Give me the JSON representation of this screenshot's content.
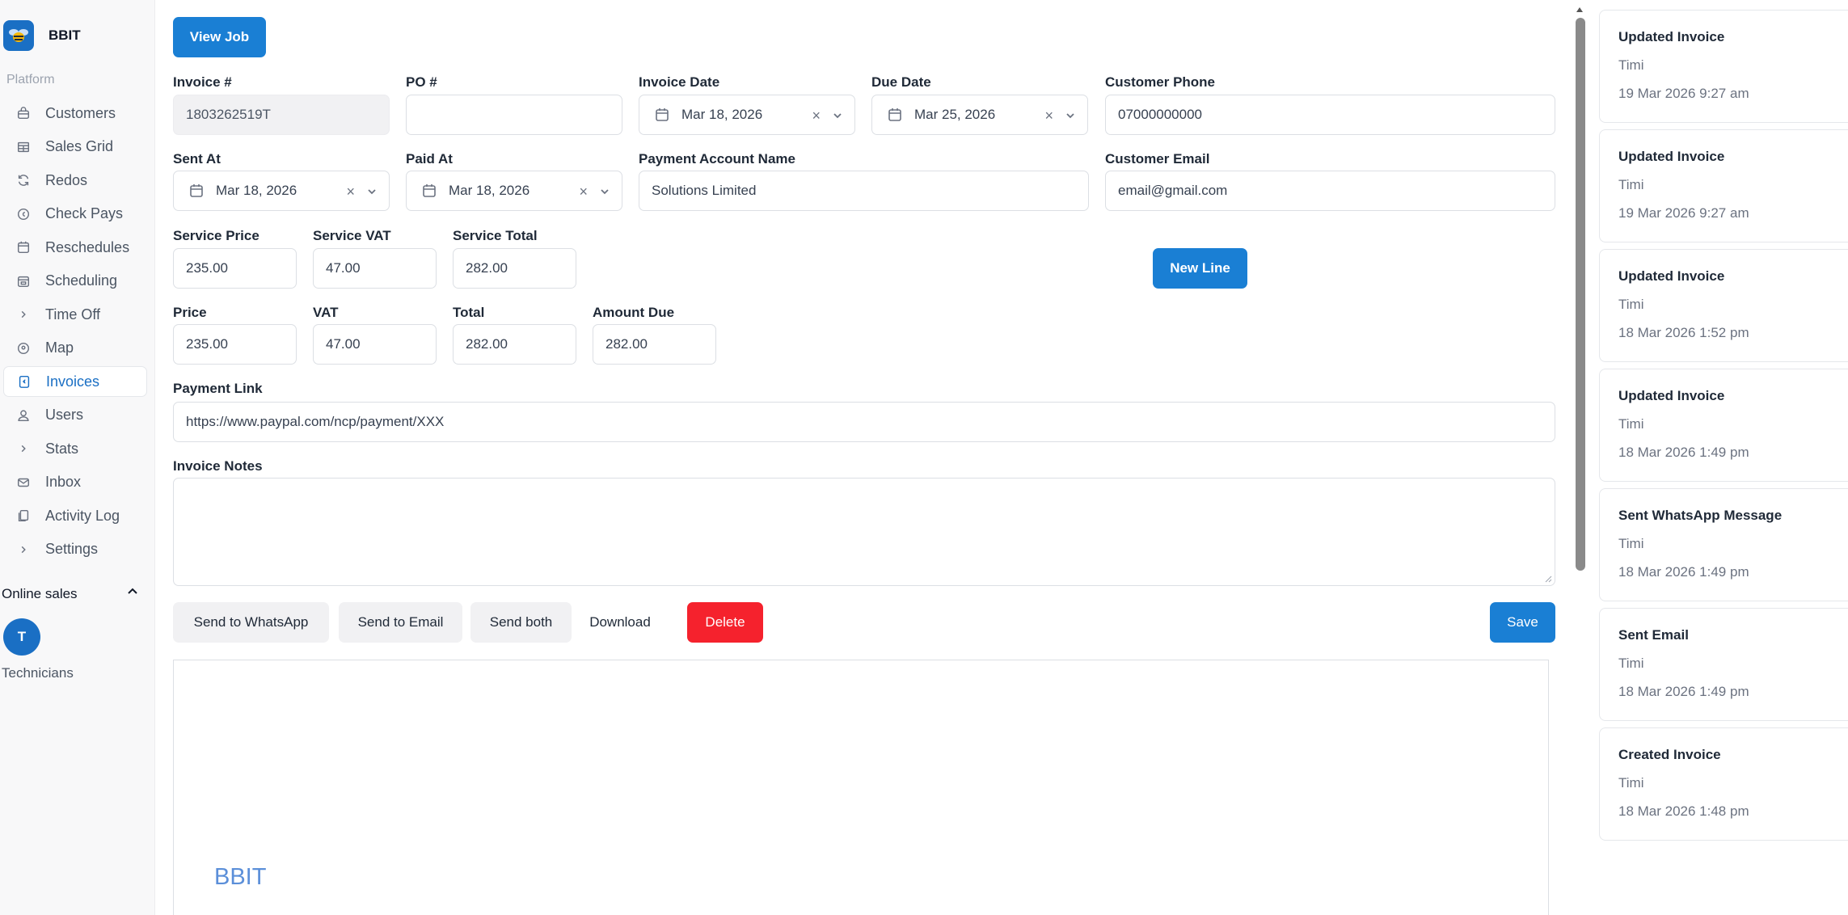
{
  "app": {
    "name": "BBIT"
  },
  "sidebar": {
    "group_label": "Platform",
    "items": [
      {
        "label": "Customers",
        "icon": "customers-icon"
      },
      {
        "label": "Sales Grid",
        "icon": "grid-icon"
      },
      {
        "label": "Redos",
        "icon": "refresh-icon"
      },
      {
        "label": "Check Pays",
        "icon": "coin-icon"
      },
      {
        "label": "Reschedules",
        "icon": "calendar-icon"
      },
      {
        "label": "Scheduling",
        "icon": "calendar-check-icon"
      },
      {
        "label": "Time Off",
        "icon": "chevron-right-icon"
      },
      {
        "label": "Map",
        "icon": "map-pin-icon"
      },
      {
        "label": "Invoices",
        "icon": "invoice-icon",
        "active": true
      },
      {
        "label": "Users",
        "icon": "user-icon"
      },
      {
        "label": "Stats",
        "icon": "chevron-right-icon"
      },
      {
        "label": "Inbox",
        "icon": "mail-icon"
      },
      {
        "label": "Activity Log",
        "icon": "files-icon"
      },
      {
        "label": "Settings",
        "icon": "chevron-right-icon"
      }
    ],
    "online_sales": {
      "label": "Online sales",
      "avatar_initial": "T",
      "technicians_label": "Technicians"
    }
  },
  "form": {
    "view_job_label": "View Job",
    "invoice_number": {
      "label": "Invoice #",
      "value": "1803262519T"
    },
    "po_number": {
      "label": "PO #",
      "value": ""
    },
    "invoice_date": {
      "label": "Invoice Date",
      "value": "Mar 18, 2026"
    },
    "due_date": {
      "label": "Due Date",
      "value": "Mar 25, 2026"
    },
    "customer_phone": {
      "label": "Customer Phone",
      "value": "07000000000"
    },
    "sent_at": {
      "label": "Sent At",
      "value": "Mar 18, 2026"
    },
    "paid_at": {
      "label": "Paid At",
      "value": "Mar 18, 2026"
    },
    "payment_account_name": {
      "label": "Payment Account Name",
      "value": "Solutions Limited"
    },
    "customer_email": {
      "label": "Customer Email",
      "value": "email@gmail.com"
    },
    "service_price": {
      "label": "Service Price",
      "value": "235.00"
    },
    "service_vat": {
      "label": "Service VAT",
      "value": "47.00"
    },
    "service_total": {
      "label": "Service Total",
      "value": "282.00"
    },
    "new_line_label": "New Line",
    "price": {
      "label": "Price",
      "value": "235.00"
    },
    "vat": {
      "label": "VAT",
      "value": "47.00"
    },
    "total": {
      "label": "Total",
      "value": "282.00"
    },
    "amount_due": {
      "label": "Amount Due",
      "value": "282.00"
    },
    "payment_link": {
      "label": "Payment Link",
      "value": "https://www.paypal.com/ncp/payment/XXX"
    },
    "invoice_notes": {
      "label": "Invoice Notes",
      "value": ""
    }
  },
  "actions": {
    "send_whatsapp": "Send to WhatsApp",
    "send_email": "Send to Email",
    "send_both": "Send both",
    "download": "Download",
    "delete": "Delete",
    "save": "Save"
  },
  "preview": {
    "brand": "BBIT"
  },
  "activity": [
    {
      "title": "Updated Invoice",
      "user": "Timi",
      "time": "19 Mar 2026 9:27 am"
    },
    {
      "title": "Updated Invoice",
      "user": "Timi",
      "time": "19 Mar 2026 9:27 am"
    },
    {
      "title": "Updated Invoice",
      "user": "Timi",
      "time": "18 Mar 2026 1:52 pm"
    },
    {
      "title": "Updated Invoice",
      "user": "Timi",
      "time": "18 Mar 2026 1:49 pm"
    },
    {
      "title": "Sent WhatsApp Message",
      "user": "Timi",
      "time": "18 Mar 2026 1:49 pm"
    },
    {
      "title": "Sent Email",
      "user": "Timi",
      "time": "18 Mar 2026 1:49 pm"
    },
    {
      "title": "Created Invoice",
      "user": "Timi",
      "time": "18 Mar 2026 1:48 pm"
    }
  ],
  "colors": {
    "accent": "#1a7fd4",
    "danger": "#f5222d",
    "sidebar_bg": "#f8f8f9"
  }
}
